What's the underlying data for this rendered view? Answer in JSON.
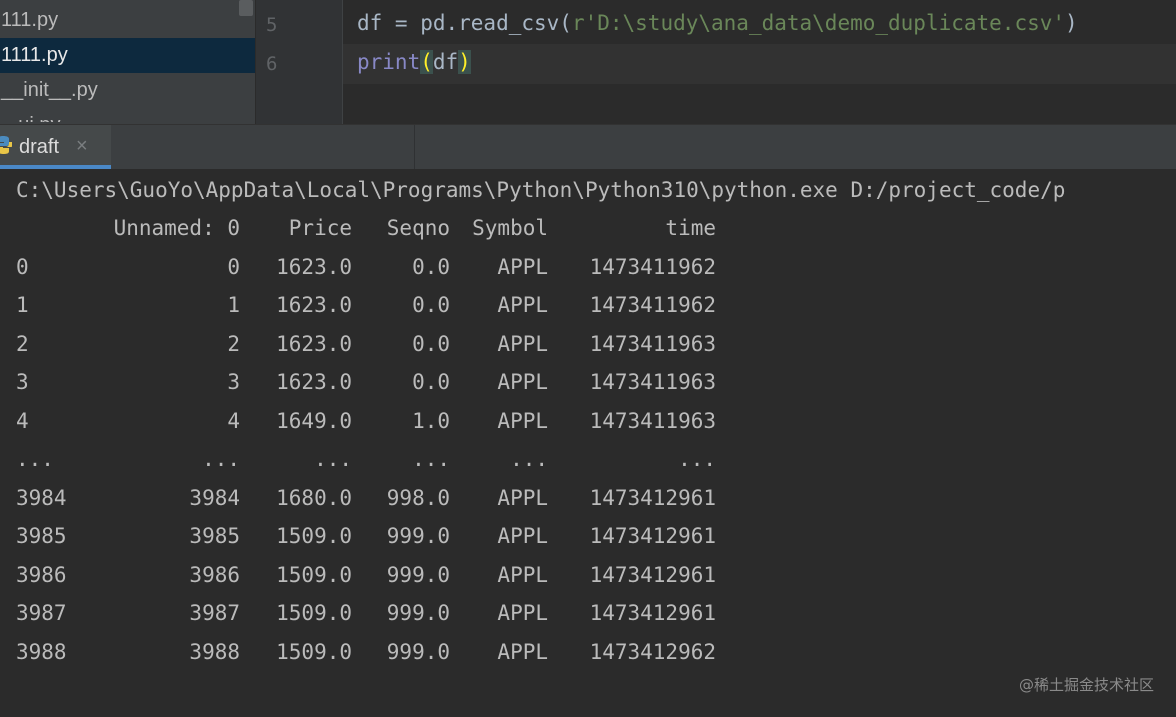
{
  "project_tree": {
    "items": [
      {
        "label": "111.py"
      },
      {
        "label": "1111.py"
      },
      {
        "label": "__init__.py"
      },
      {
        "label": "~.ui.py"
      }
    ]
  },
  "editor": {
    "lines": [
      {
        "number": "5",
        "code": {
          "a": "df = pd.read_csv(",
          "str": "r'D:\\study\\ana_data\\demo_duplicate.csv'",
          "b": ")"
        }
      },
      {
        "number": "6",
        "code": {
          "builtin": "print",
          "open": "(",
          "arg": "df",
          "close": ")"
        }
      }
    ]
  },
  "run_tool_window": {
    "tab_label": "draft",
    "close_glyph": "×"
  },
  "console": {
    "command": "C:\\Users\\GuoYo\\AppData\\Local\\Programs\\Python\\Python310\\python.exe D:/project_code/p",
    "headers": [
      "",
      "Unnamed: 0",
      "Price",
      "Seqno",
      "Symbol",
      "time"
    ],
    "rows": [
      [
        "0",
        "0",
        "1623.0",
        "0.0",
        "APPL",
        "1473411962"
      ],
      [
        "1",
        "1",
        "1623.0",
        "0.0",
        "APPL",
        "1473411962"
      ],
      [
        "2",
        "2",
        "1623.0",
        "0.0",
        "APPL",
        "1473411963"
      ],
      [
        "3",
        "3",
        "1623.0",
        "0.0",
        "APPL",
        "1473411963"
      ],
      [
        "4",
        "4",
        "1649.0",
        "1.0",
        "APPL",
        "1473411963"
      ],
      [
        "...",
        "...",
        "...",
        "...",
        "...",
        "..."
      ],
      [
        "3984",
        "3984",
        "1680.0",
        "998.0",
        "APPL",
        "1473412961"
      ],
      [
        "3985",
        "3985",
        "1509.0",
        "999.0",
        "APPL",
        "1473412961"
      ],
      [
        "3986",
        "3986",
        "1509.0",
        "999.0",
        "APPL",
        "1473412961"
      ],
      [
        "3987",
        "3987",
        "1509.0",
        "999.0",
        "APPL",
        "1473412961"
      ],
      [
        "3988",
        "3988",
        "1509.0",
        "999.0",
        "APPL",
        "1473412962"
      ]
    ]
  },
  "watermark": "@稀土掘金技术社区",
  "colors": {
    "accent": "#4a88c7",
    "string": "#6a8759",
    "builtin": "#8888c6",
    "text": "#bbbbbb"
  }
}
